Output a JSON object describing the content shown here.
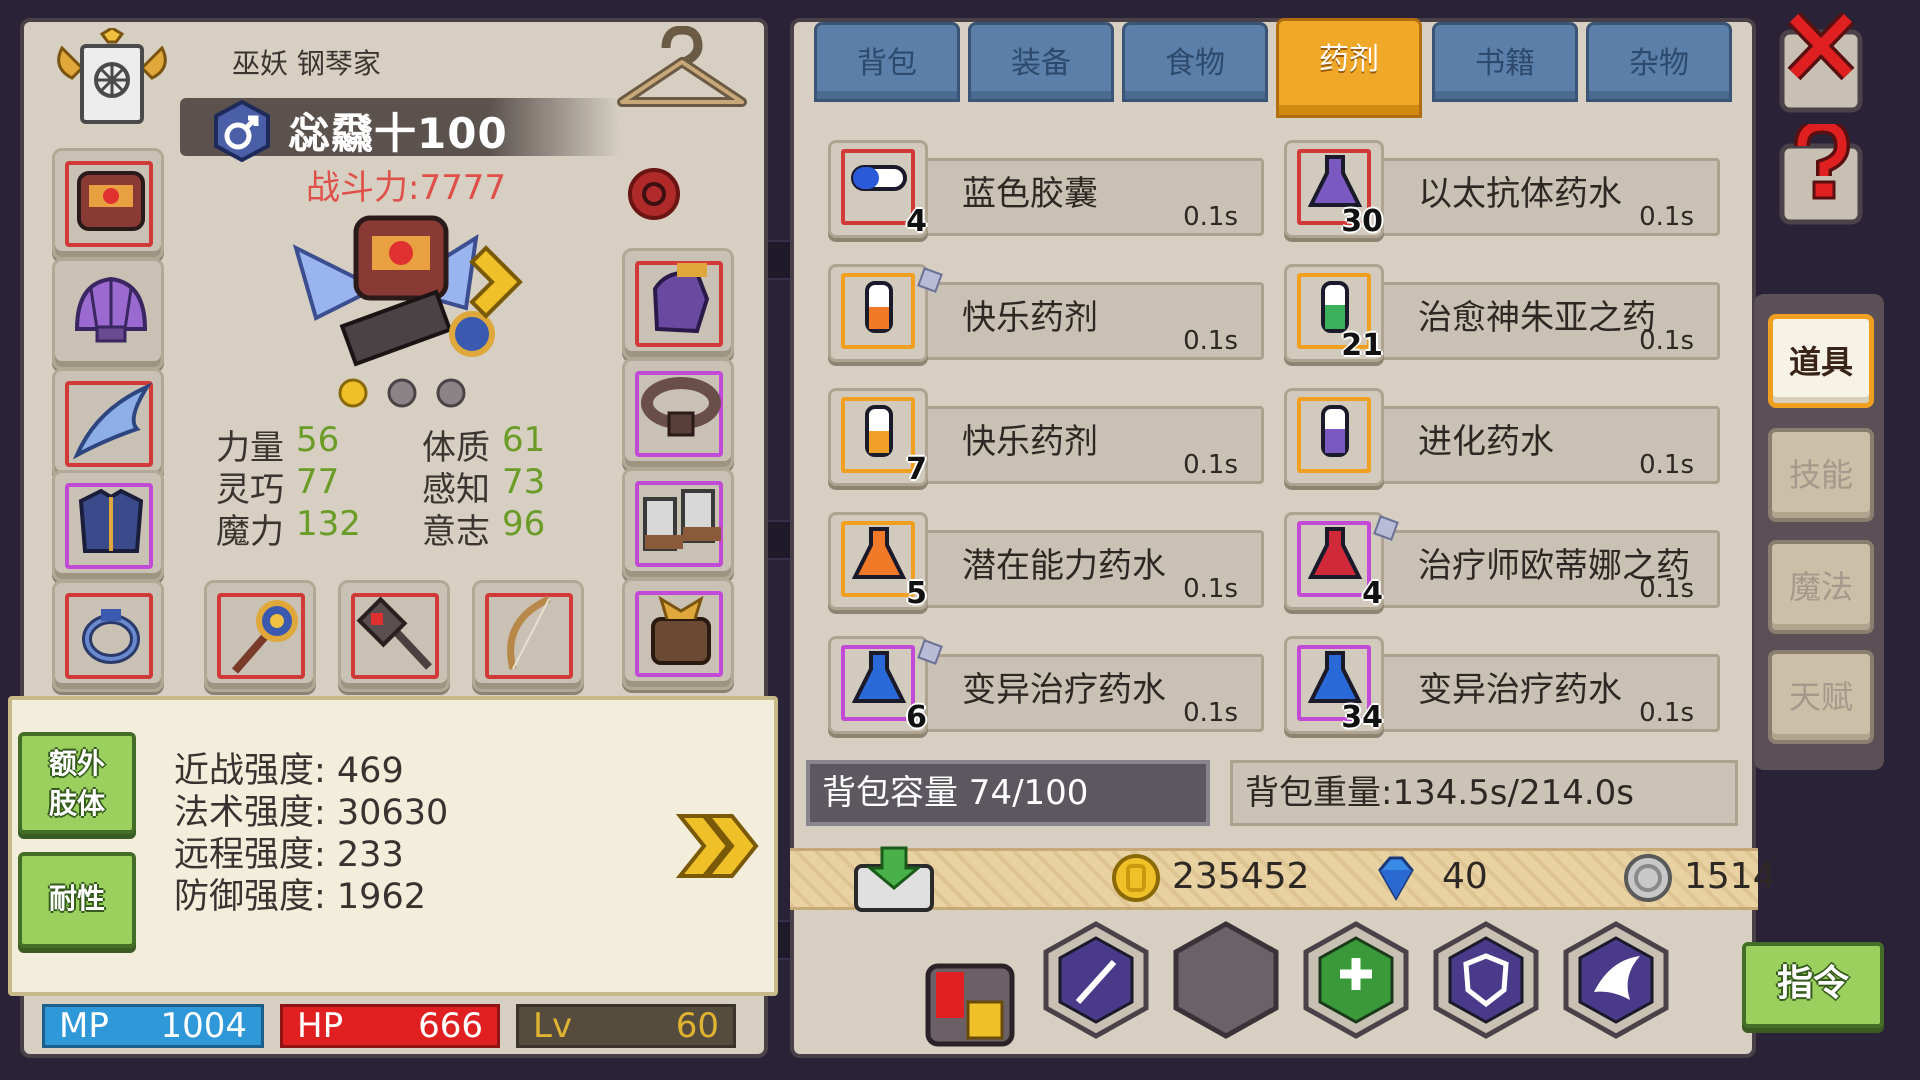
{
  "character": {
    "name": "巫妖 钢琴家",
    "title": "惢飝十100",
    "power": "战斗力:7777",
    "stats": [
      {
        "label": "力量",
        "value": "56"
      },
      {
        "label": "体质",
        "value": "61"
      },
      {
        "label": "灵巧",
        "value": "77"
      },
      {
        "label": "感知",
        "value": "73"
      },
      {
        "label": "魔力",
        "value": "132"
      },
      {
        "label": "意志",
        "value": "96"
      }
    ],
    "extra_limbs_label": "额外肢体",
    "extra_limbs_line1": "额外",
    "extra_limbs_line2": "肢体",
    "resist_label": "耐性",
    "details": [
      "近战强度: 469",
      "法术强度: 30630",
      "远程强度: 233",
      "防御强度: 1962"
    ],
    "mp": {
      "label": "MP",
      "value": "1004"
    },
    "hp": {
      "label": "HP",
      "value": "666"
    },
    "lv": {
      "label": "Lv",
      "value": "60"
    }
  },
  "tabs": [
    {
      "label": "背包",
      "active": false
    },
    {
      "label": "装备",
      "active": false
    },
    {
      "label": "食物",
      "active": false
    },
    {
      "label": "药剂",
      "active": true
    },
    {
      "label": "书籍",
      "active": false
    },
    {
      "label": "杂物",
      "active": false
    }
  ],
  "items": [
    {
      "name": "蓝色胶囊",
      "count": "4",
      "weight": "0.1s",
      "rarity": "red",
      "icon": "blue-capsule-icon"
    },
    {
      "name": "以太抗体药水",
      "count": "30",
      "weight": "0.1s",
      "rarity": "red",
      "icon": "purple-flask-icon"
    },
    {
      "name": "快乐药剂",
      "count": "",
      "weight": "0.1s",
      "rarity": "orange",
      "icon": "orange-vial-icon"
    },
    {
      "name": "治愈神朱亚之药",
      "count": "21",
      "weight": "0.1s",
      "rarity": "orange",
      "icon": "green-vial-icon"
    },
    {
      "name": "快乐药剂",
      "count": "7",
      "weight": "0.1s",
      "rarity": "orange",
      "icon": "orange-vial-icon"
    },
    {
      "name": "进化药水",
      "count": "",
      "weight": "0.1s",
      "rarity": "orange",
      "icon": "purple-vial-icon"
    },
    {
      "name": "潜在能力药水",
      "count": "5",
      "weight": "0.1s",
      "rarity": "orange",
      "icon": "orange-flask-icon"
    },
    {
      "name": "治疗师欧蒂娜之药",
      "count": "4",
      "weight": "0.1s",
      "rarity": "purple",
      "icon": "red-flask-icon"
    },
    {
      "name": "变异治疗药水",
      "count": "6",
      "weight": "0.1s",
      "rarity": "purple",
      "icon": "blue-flask-icon"
    },
    {
      "name": "变异治疗药水",
      "count": "34",
      "weight": "0.1s",
      "rarity": "purple",
      "icon": "blue-flask-icon"
    }
  ],
  "inventory": {
    "capacity": "背包容量 74/100",
    "weight": "背包重量:134.5s/214.0s"
  },
  "currency": {
    "gold": "235452",
    "gems": "40",
    "silver": "1514"
  },
  "side_tabs": [
    {
      "label": "道具",
      "active": true
    },
    {
      "label": "技能",
      "active": false
    },
    {
      "label": "魔法",
      "active": false
    },
    {
      "label": "天赋",
      "active": false
    }
  ],
  "command_label": "指令",
  "colors": {
    "accent_orange": "#f0a828",
    "tab_blue": "#5b7fa8",
    "stat_green": "#6b9c28",
    "power_red": "#e0504a",
    "mp_blue": "#2e98d8",
    "hp_red": "#e02020"
  }
}
